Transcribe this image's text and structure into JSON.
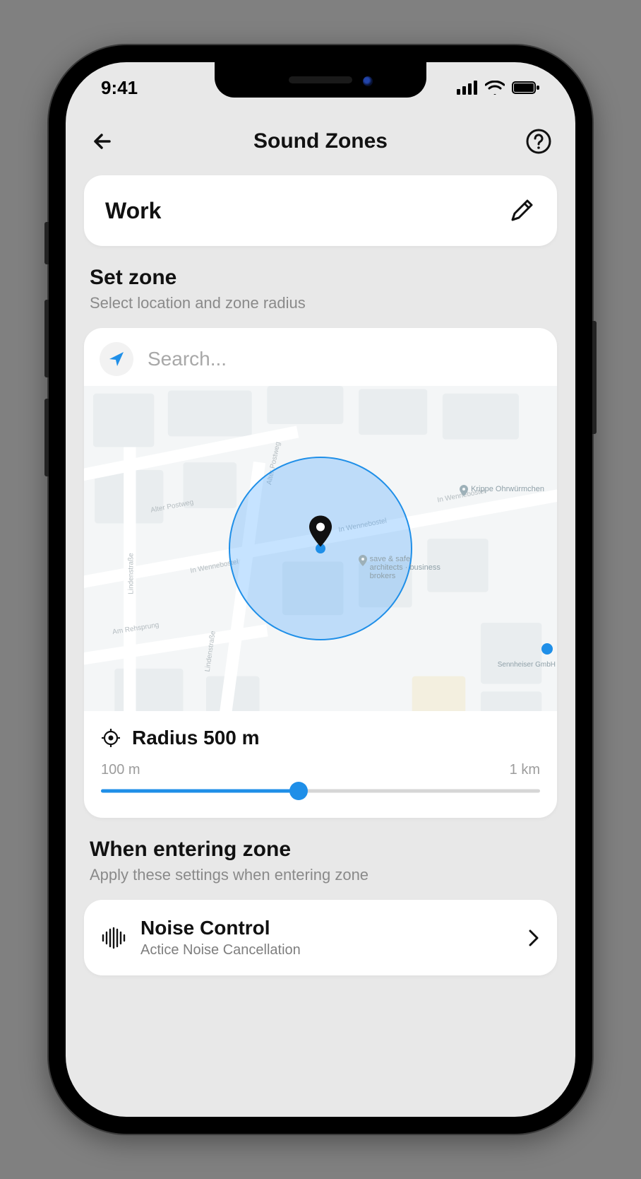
{
  "status": {
    "time": "9:41"
  },
  "nav": {
    "title": "Sound Zones"
  },
  "zone": {
    "name": "Work"
  },
  "set_zone": {
    "title": "Set zone",
    "subtitle": "Select location and zone radius",
    "search_placeholder": "Search...",
    "radius_label": "Radius 500 m",
    "slider_min_label": "100 m",
    "slider_max_label": "1 km",
    "map_poi": {
      "right_top": "In Wennebostel",
      "right_top_name": "Krippe Ohrwürmchen",
      "center_name": "save & safe architects · business brokers",
      "left_far": "Lindenstraße",
      "left_top": "Alter Postweg",
      "bottom_left": "Am Rehsprung",
      "bottom_right_name": "Sennheiser GmbH"
    }
  },
  "entering": {
    "title": "When entering zone",
    "subtitle": "Apply these settings when entering zone"
  },
  "noise_control": {
    "title": "Noise Control",
    "subtitle": "Actice Noise Cancellation"
  },
  "colors": {
    "accent": "#1f8fe8"
  }
}
